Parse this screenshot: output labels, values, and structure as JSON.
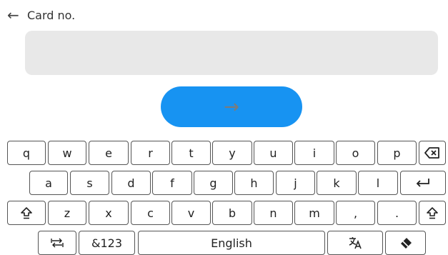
{
  "header": {
    "back_glyph": "←",
    "title": "Card no."
  },
  "input": {
    "value": "",
    "placeholder": ""
  },
  "submit": {
    "icon": "arrow-right-icon",
    "glyph": "→",
    "color": "#1793f2"
  },
  "keyboard": {
    "row1": [
      "q",
      "w",
      "e",
      "r",
      "t",
      "y",
      "u",
      "i",
      "o",
      "p"
    ],
    "row2": [
      "a",
      "s",
      "d",
      "f",
      "g",
      "h",
      "j",
      "k",
      "l"
    ],
    "row3": [
      "z",
      "x",
      "c",
      "v",
      "b",
      "n",
      "m",
      ",",
      "."
    ],
    "symbols_label": "&123",
    "space_label": "English",
    "icons": {
      "backspace": "backspace-icon",
      "enter": "enter-icon",
      "shift_left": "shift-icon",
      "shift_right": "shift-icon",
      "switch": "keyboard-switch-icon",
      "translate": "translate-icon",
      "handwriting": "handwriting-icon"
    }
  }
}
